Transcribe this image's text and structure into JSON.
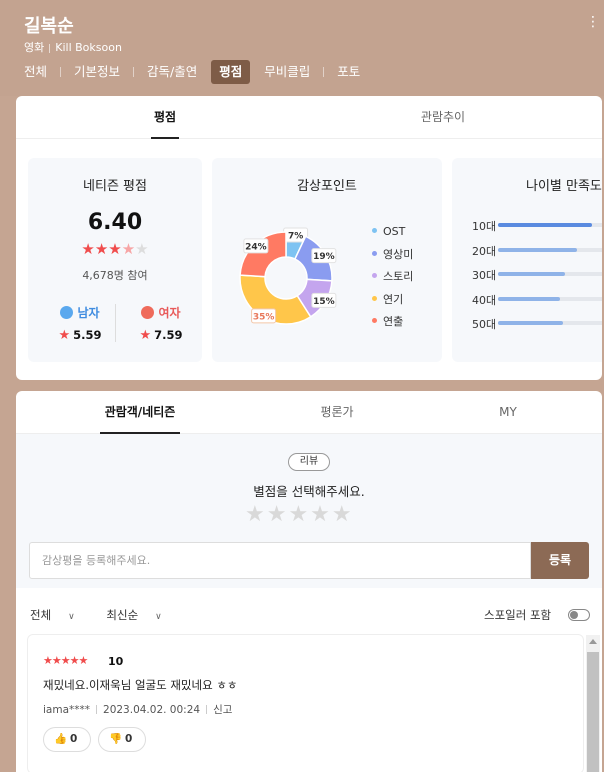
{
  "header": {
    "title": "길복순",
    "category": "영화",
    "english_title": "Kill Boksoon",
    "nav": [
      "전체",
      "기본정보",
      "감독/출연",
      "평점",
      "무비클립",
      "포토"
    ],
    "active_nav": "평점"
  },
  "rating_card": {
    "tabs": [
      "평점",
      "관람추이"
    ],
    "active_tab": "평점",
    "netizen": {
      "title": "네티즌 평점",
      "score": "6.40",
      "stars_filled": 3.2,
      "participants": "4,678명 참여",
      "male": {
        "label": "남자",
        "score": "5.59"
      },
      "female": {
        "label": "여자",
        "score": "7.59"
      }
    },
    "points": {
      "title": "감상포인트",
      "legend": [
        {
          "label": "OST",
          "color": "#7ec3f2"
        },
        {
          "label": "영상미",
          "color": "#8a9cf0"
        },
        {
          "label": "스토리",
          "color": "#c4a5ee"
        },
        {
          "label": "연기",
          "color": "#ffc64a"
        },
        {
          "label": "연출",
          "color": "#ff7a63"
        }
      ]
    },
    "age": {
      "title": "나이별 만족도",
      "rows": [
        {
          "label": "10대",
          "value": 0.78
        },
        {
          "label": "20대",
          "value": 0.66
        },
        {
          "label": "30대",
          "value": 0.56
        },
        {
          "label": "40대",
          "value": 0.52
        },
        {
          "label": "50대",
          "value": 0.54
        }
      ]
    }
  },
  "chart_data": {
    "type": "pie",
    "title": "감상포인트",
    "categories": [
      "OST",
      "영상미",
      "스토리",
      "연기",
      "연출"
    ],
    "values": [
      7,
      19,
      15,
      35,
      24
    ],
    "labels": [
      "7%",
      "19%",
      "15%",
      "35%",
      "24%"
    ],
    "colors": [
      "#7ec3f2",
      "#8a9cf0",
      "#c4a5ee",
      "#ffc64a",
      "#ff7a63"
    ]
  },
  "review_card": {
    "tabs": [
      "관람객/네티즌",
      "평론가",
      "MY"
    ],
    "active_tab": "관람객/네티즌",
    "badge": "리뷰",
    "prompt": "별점을 선택해주세요.",
    "empty_stars": "★★★★★",
    "input_placeholder": "감상평을 등록해주세요.",
    "submit": "등록",
    "filter_all": "전체",
    "filter_sort": "최신순",
    "spoiler_label": "스포일러 포함",
    "review": {
      "stars": "★★★★★",
      "score": "10",
      "text": "재밌네요.이재욱님 얼굴도 재밌네요 ㅎㅎ",
      "user": "iama****",
      "date": "2023.04.02. 00:24",
      "report": "신고",
      "likes": "0",
      "dislikes": "0"
    }
  }
}
